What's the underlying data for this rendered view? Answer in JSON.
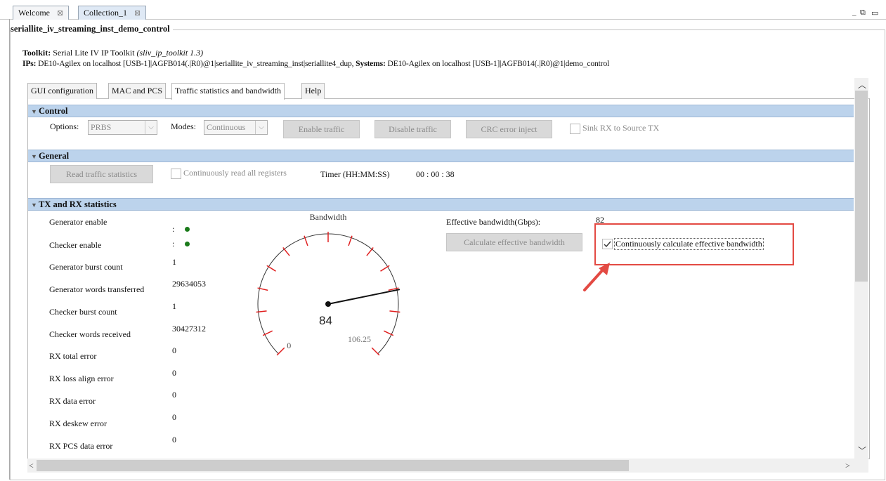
{
  "editor_tabs": [
    {
      "label": "Welcome"
    },
    {
      "label": "Collection_1"
    }
  ],
  "tab_close_glyph": "⊠",
  "window_controls": {
    "minimize": "_",
    "restore": "⧉",
    "maximize": "▭"
  },
  "group_title": "seriallite_iv_streaming_inst_demo_control",
  "toolkit": {
    "label": "Toolkit:",
    "name": "Serial Lite IV IP Toolkit",
    "id": "(sliv_ip_toolkit 1.3)"
  },
  "ips": {
    "label": "IPs:",
    "value": "DE10-Agilex on localhost [USB-1]|AGFB014(.|R0)@1|seriallite_iv_streaming_inst|seriallite4_dup,",
    "systems_label": "Systems:",
    "systems_value": "DE10-Agilex on localhost [USB-1]|AGFB014(.|R0)@1|demo_control"
  },
  "inner_tabs": [
    "GUI configuration",
    "MAC and PCS",
    "Traffic statistics and bandwidth",
    "Help"
  ],
  "control": {
    "title": "Control",
    "options_label": "Options:",
    "options_value": "PRBS",
    "modes_label": "Modes:",
    "modes_value": "Continuous",
    "enable_traffic": "Enable traffic",
    "disable_traffic": "Disable traffic",
    "crc_inject": "CRC error inject",
    "sink_rx": "Sink RX to Source TX"
  },
  "general": {
    "title": "General",
    "read_stats": "Read traffic statistics",
    "continuously_read": "Continuously read all registers",
    "timer_label": "Timer (HH:MM:SS)",
    "timer_value": "00 : 00 : 38"
  },
  "txrx": {
    "title": "TX and RX statistics",
    "stats": [
      {
        "label": "Generator enable",
        "value": ":",
        "dot": true
      },
      {
        "label": "Checker enable",
        "value": ":",
        "dot": true
      },
      {
        "label": "Generator burst count",
        "value": "1"
      },
      {
        "label": "Generator words transferred",
        "value": "29634053"
      },
      {
        "label": "Checker burst count",
        "value": "1"
      },
      {
        "label": "Checker words received",
        "value": "30427312"
      },
      {
        "label": "RX total error",
        "value": "0"
      },
      {
        "label": "RX loss align error",
        "value": "0"
      },
      {
        "label": "RX data error",
        "value": "0"
      },
      {
        "label": "RX deskew error",
        "value": "0"
      },
      {
        "label": "RX PCS data error",
        "value": "0"
      }
    ],
    "gauge": {
      "title": "Bandwidth",
      "value": 84,
      "min": 0,
      "max": 106.25,
      "value_label": "84",
      "min_label": "0",
      "max_label": "106.25"
    },
    "effective_label": "Effective bandwidth(Gbps):",
    "effective_value": "82",
    "calc_button": "Calculate effective bandwidth",
    "continuously_calc": "Continuously calculate effective bandwidth",
    "continuously_calc_checked": true
  },
  "colors": {
    "section_header": "#bcd3ec",
    "accent_red": "#e34a43",
    "status_green": "#1a7a1a",
    "gauge_tick": "#e02020"
  }
}
